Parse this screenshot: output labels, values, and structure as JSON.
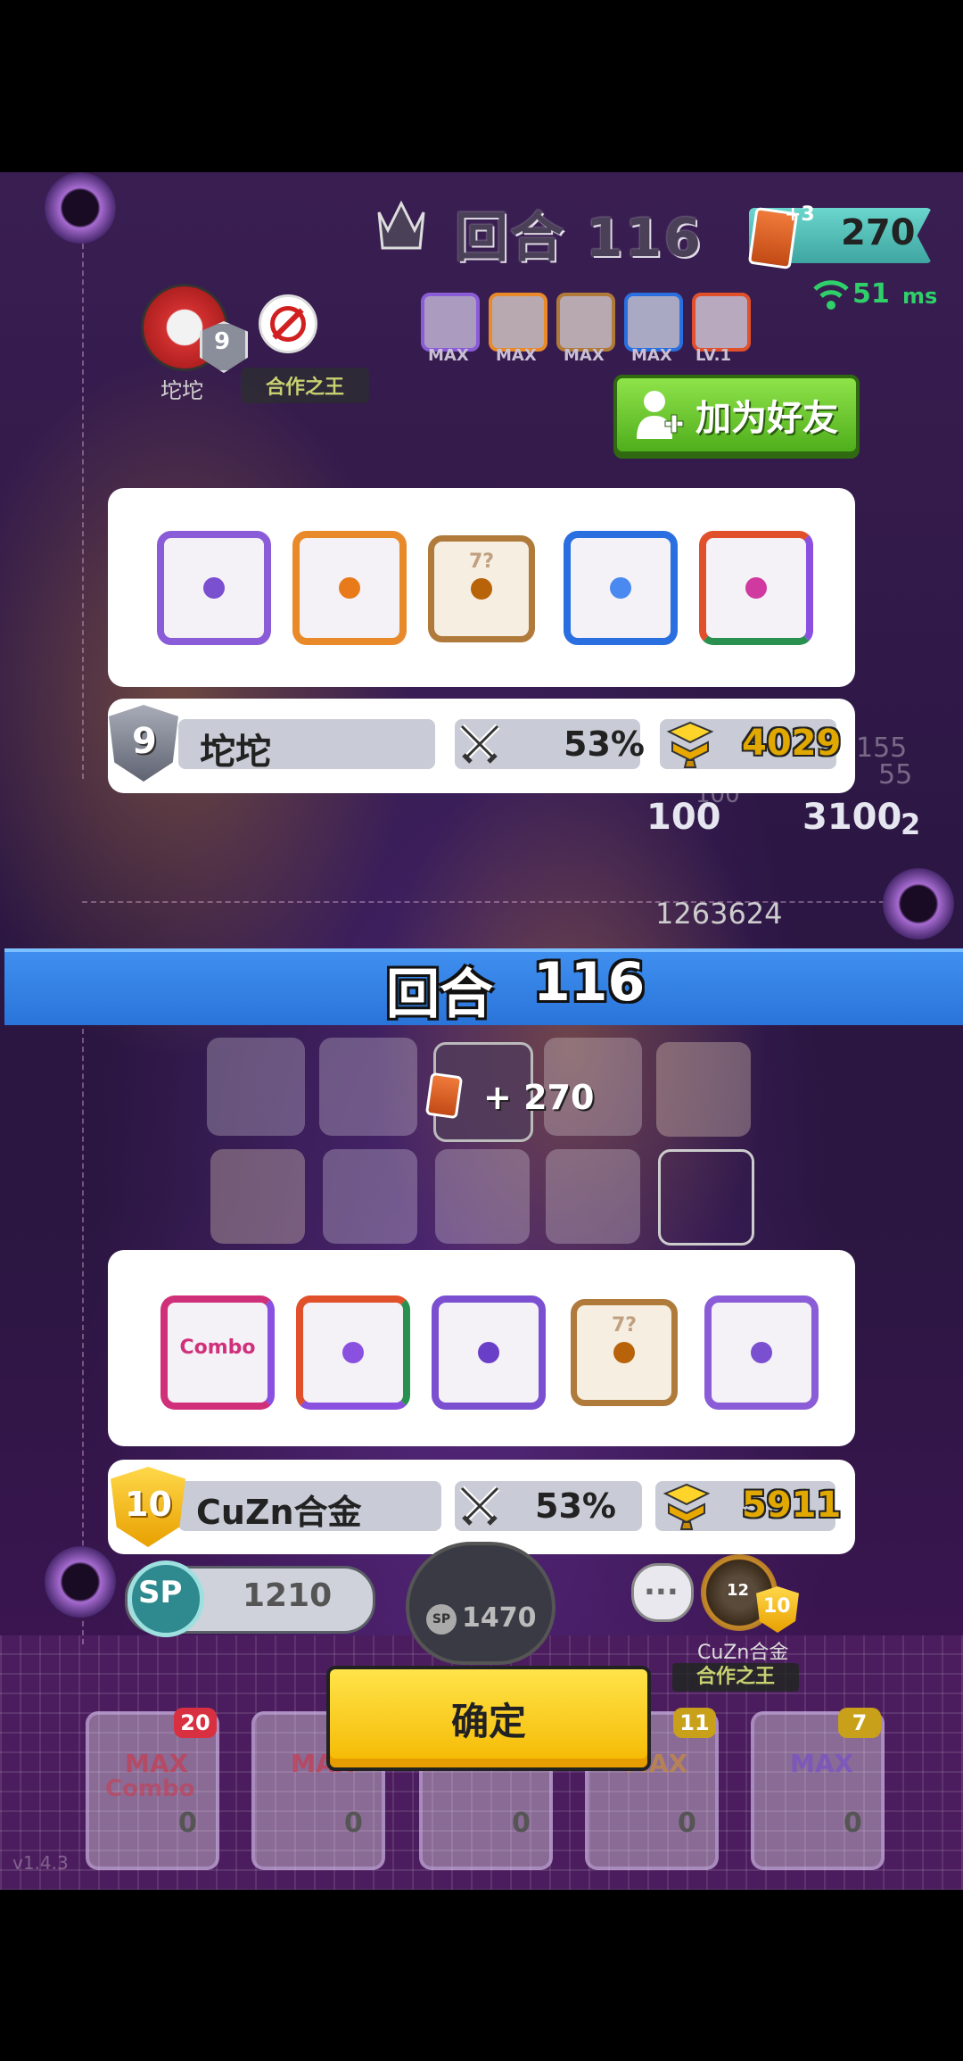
{
  "colors": {
    "banner": "#3f8ff0",
    "confirm": "#ffd21a",
    "add_friend": "#6cc82f",
    "panel": "#ffffff",
    "stat_bar": "#c9ccd6"
  },
  "top": {
    "round_label": "回合 116",
    "card_count": "270",
    "card_plus": "+3",
    "ping_value": "51",
    "ping_unit": "ms",
    "opponent_name": "坨坨",
    "opponent_title": "合作之王",
    "opponent_rank": "9",
    "add_friend_label": "加为好友",
    "deck_levels": [
      "MAX",
      "MAX",
      "MAX",
      "MAX",
      "LV.1"
    ],
    "board_numbers": [
      "100",
      "3100",
      "2",
      "1263624",
      "155",
      "55",
      "100"
    ]
  },
  "player1": {
    "dice": [
      {
        "name": "purple-orb-dice",
        "color": "#8a5cd8",
        "pip": "#7a4fd0"
      },
      {
        "name": "orange-dice",
        "color": "#e88a2a",
        "pip": "#e87a1a"
      },
      {
        "name": "mystery-dice",
        "color": "#b07a3a",
        "pip": "#b8620a",
        "label": "7?"
      },
      {
        "name": "snow-dice",
        "color": "#2a6fe0",
        "pip": "#4a8af0"
      },
      {
        "name": "rainbow-dice",
        "color": "#e0502a",
        "pip": "#d03aa0"
      }
    ],
    "rank": "9",
    "name": "坨坨",
    "win_rate": "53%",
    "trophies": "4029"
  },
  "banner": {
    "label": "回合",
    "round": "116"
  },
  "reward": {
    "text": "+ 270"
  },
  "player2": {
    "dice": [
      {
        "name": "combo-dice",
        "color": "#d0307a",
        "pip": "#d83070",
        "label": "Combo"
      },
      {
        "name": "rainbow-dice",
        "color": "#e0502a",
        "pip": "#8a50e0"
      },
      {
        "name": "purple-light-dice",
        "color": "#7a4fd0",
        "pip": "#6a3fc8"
      },
      {
        "name": "mystery-dice",
        "color": "#b07a3a",
        "pip": "#b8620a",
        "label": "7?"
      },
      {
        "name": "purple-orb-dice",
        "color": "#8a5cd8",
        "pip": "#7a4fd0"
      }
    ],
    "rank": "10",
    "name": "CuZn合金",
    "win_rate": "53%",
    "trophies": "5911"
  },
  "bottom": {
    "sp_icon": "SP",
    "sp_value": "1210",
    "summon_cost": "1470",
    "chat_icon": "...",
    "player_name": "CuZn合金",
    "player_title": "合作之王",
    "player_rank": "10",
    "player_level": "12",
    "confirm_label": "确定",
    "deck_cards": [
      {
        "badge": "20",
        "label": "MAX",
        "sub": "Combo",
        "sp": "0",
        "badge_color": "#d83040"
      },
      {
        "badge": "",
        "label": "MAX",
        "sub": "",
        "sp": "0",
        "badge_color": "#d83040"
      },
      {
        "badge": "",
        "label": "",
        "sub": "",
        "sp": "0",
        "badge_color": "#d83040"
      },
      {
        "badge": "11",
        "label": "MAX",
        "sub": "",
        "sp": "0",
        "badge_color": "#c8a01a"
      },
      {
        "badge": "7",
        "label": "MAX",
        "sub": "",
        "sp": "0",
        "badge_color": "#c8a01a"
      }
    ],
    "version": "v1.4.3"
  }
}
